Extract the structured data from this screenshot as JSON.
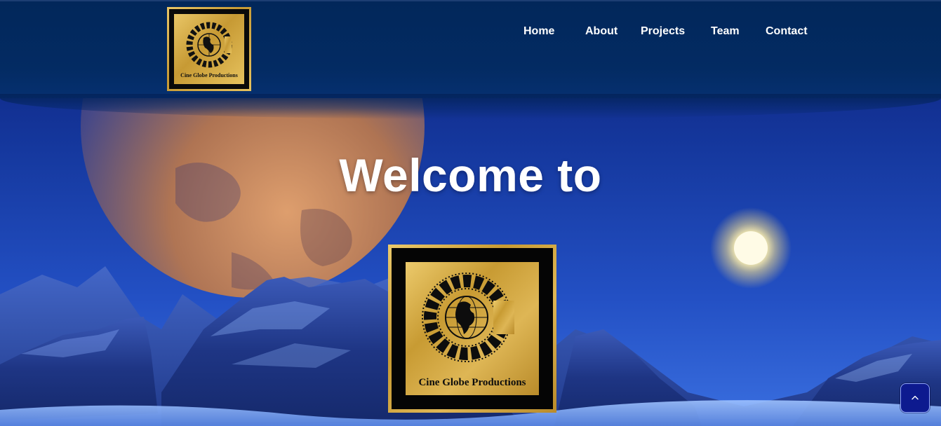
{
  "header": {
    "brand": {
      "logo_icon": "cine-globe-logo-icon",
      "logo_text": "Cine Globe Productions"
    },
    "nav": [
      {
        "label": "Home"
      },
      {
        "label": "About"
      },
      {
        "label": "Projects"
      },
      {
        "label": "Team"
      },
      {
        "label": "Contact"
      }
    ]
  },
  "hero": {
    "title": "Welcome to",
    "logo_icon": "cine-globe-logo-icon",
    "logo_text": "Cine Globe Productions",
    "background": "planet-moon-mountains-scene"
  },
  "scroll_top": {
    "icon": "chevron-up-icon"
  },
  "colors": {
    "header_bg": "#02275a",
    "nav_text": "#ffffff",
    "sky_top": "#0d2c8a",
    "sky_bottom": "#2b5cd6",
    "gold": "#c9a03a",
    "button_bg": "#0d1a8f"
  }
}
